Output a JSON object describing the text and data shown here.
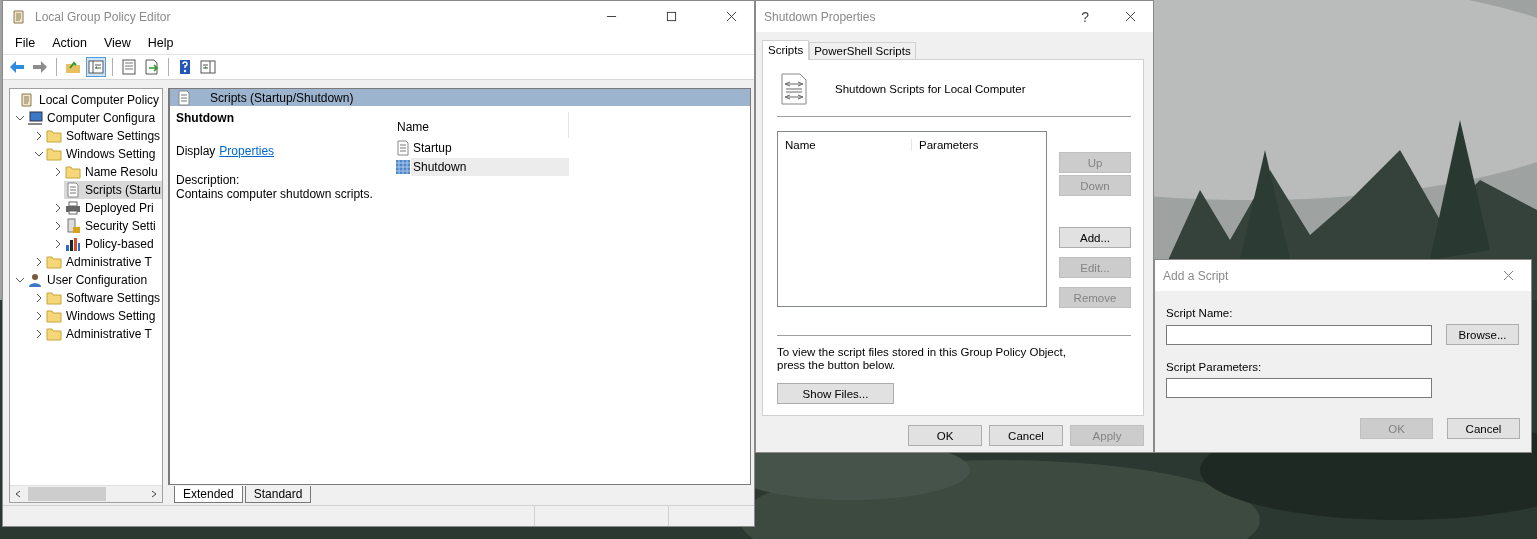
{
  "editor": {
    "title": "Local Group Policy Editor",
    "menu": [
      "File",
      "Action",
      "View",
      "Help"
    ],
    "toolbar": [
      [
        {
          "kind": "back",
          "pressed": false
        },
        {
          "kind": "forward",
          "pressed": false
        }
      ],
      [
        {
          "kind": "up",
          "pressed": false
        },
        {
          "kind": "tree",
          "pressed": true
        }
      ],
      [
        {
          "kind": "properties",
          "pressed": false
        },
        {
          "kind": "export",
          "pressed": false
        }
      ],
      [
        {
          "kind": "help",
          "pressed": false
        },
        {
          "kind": "pane",
          "pressed": false
        }
      ]
    ],
    "tree": [
      {
        "label": "Local Computer Policy",
        "kind": "policy",
        "selected": false,
        "children": [
          {
            "label": "Computer Configura",
            "kind": "computer",
            "expanded": true,
            "selected": false,
            "children": [
              {
                "label": "Software Settings",
                "kind": "folder",
                "expanded": false,
                "selected": false
              },
              {
                "label": "Windows Setting",
                "kind": "folder",
                "expanded": true,
                "selected": false,
                "children": [
                  {
                    "label": "Name Resolu",
                    "kind": "folder",
                    "expanded": false,
                    "selected": false
                  },
                  {
                    "label": "Scripts (Startu",
                    "kind": "scripts",
                    "selected": true
                  },
                  {
                    "label": "Deployed Pri",
                    "kind": "printer",
                    "expanded": false,
                    "selected": false
                  },
                  {
                    "label": "Security Setti",
                    "kind": "security",
                    "expanded": false,
                    "selected": false
                  },
                  {
                    "label": "Policy-based",
                    "kind": "chart",
                    "expanded": false,
                    "selected": false
                  }
                ]
              },
              {
                "label": "Administrative T",
                "kind": "folder",
                "expanded": false,
                "selected": false
              }
            ]
          },
          {
            "label": "User Configuration",
            "kind": "user",
            "expanded": true,
            "selected": false,
            "children": [
              {
                "label": "Software Settings",
                "kind": "folder",
                "expanded": false,
                "selected": false
              },
              {
                "label": "Windows Setting",
                "kind": "folder",
                "expanded": false,
                "selected": false
              },
              {
                "label": "Administrative T",
                "kind": "folder",
                "expanded": false,
                "selected": false
              }
            ]
          }
        ]
      }
    ],
    "header": "Scripts (Startup/Shutdown)",
    "details": {
      "heading": "Shutdown",
      "display_label": "Display",
      "link": "Properties",
      "description_label": "Description:",
      "description": "Contains computer shutdown scripts."
    },
    "list": {
      "column": "Name",
      "items": [
        {
          "label": "Startup",
          "kind": "startup",
          "selected": false
        },
        {
          "label": "Shutdown",
          "kind": "shutdown",
          "selected": true
        }
      ]
    },
    "view_tabs": [
      {
        "label": "Extended",
        "selected": true
      },
      {
        "label": "Standard",
        "selected": false
      }
    ]
  },
  "properties_dialog": {
    "title": "Shutdown Properties",
    "help": "?",
    "tabs": [
      {
        "label": "Scripts",
        "selected": true
      },
      {
        "label": "PowerShell Scripts",
        "selected": false
      }
    ],
    "heading": "Shutdown Scripts for Local Computer",
    "columns": [
      "Name",
      "Parameters"
    ],
    "side_buttons": [
      {
        "label": "Up",
        "disabled": true
      },
      {
        "label": "Down",
        "disabled": true
      },
      {
        "label": "Add...",
        "disabled": false
      },
      {
        "label": "Edit...",
        "disabled": true
      },
      {
        "label": "Remove",
        "disabled": true
      }
    ],
    "note": "To view the script files stored in this Group Policy Object, press the button below.",
    "show_files": "Show Files...",
    "buttons": [
      {
        "label": "OK",
        "disabled": false
      },
      {
        "label": "Cancel",
        "disabled": false
      },
      {
        "label": "Apply",
        "disabled": true
      }
    ]
  },
  "add_script_dialog": {
    "title": "Add a Script",
    "name_label": "Script Name:",
    "browse": "Browse...",
    "params_label": "Script Parameters:",
    "buttons": [
      {
        "label": "OK",
        "disabled": true
      },
      {
        "label": "Cancel",
        "disabled": false
      }
    ]
  }
}
